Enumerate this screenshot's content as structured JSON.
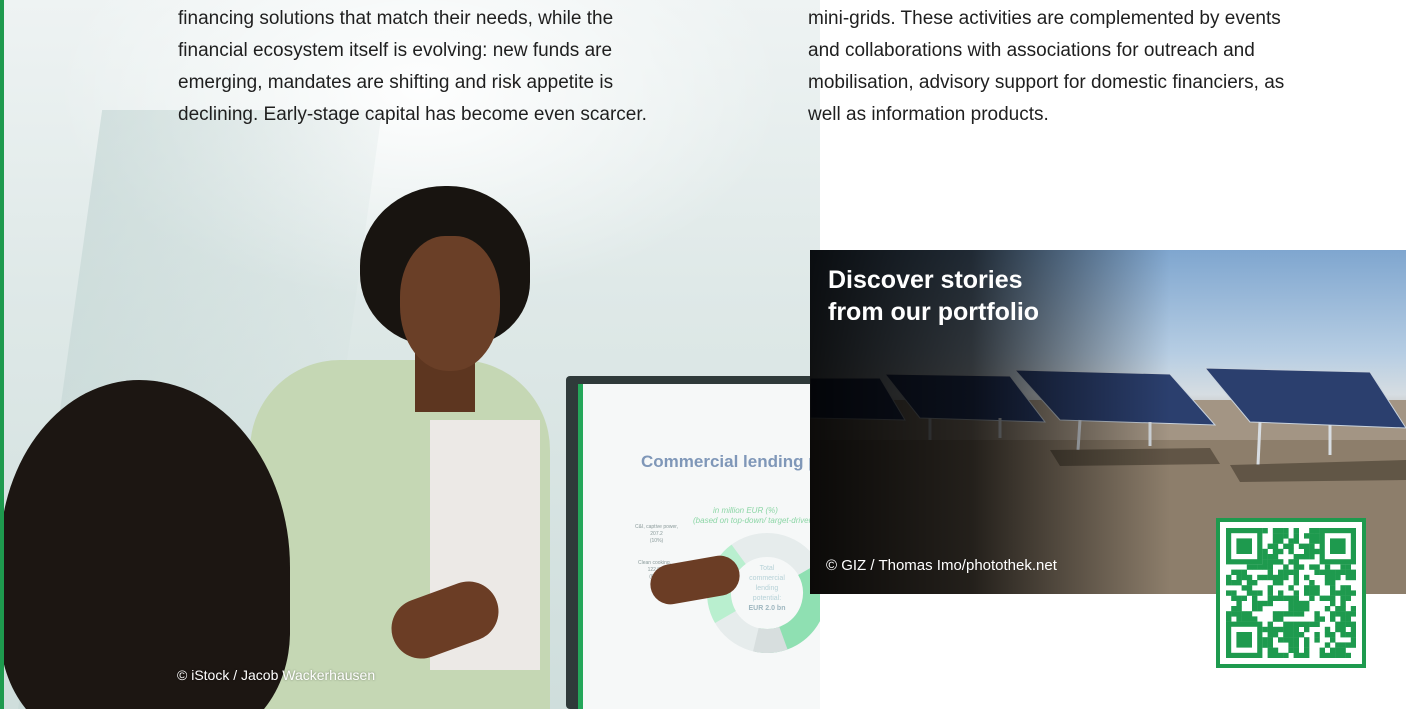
{
  "left_column": {
    "lines": [
      "financing solutions that match their needs, while the",
      "financial ecosystem itself is evolving: new funds are",
      "emerging, mandates are shifting and risk appetite is",
      "declining. Early-stage capital has become even scarcer."
    ]
  },
  "right_column": {
    "lines": [
      "mini-grids. These activities are complemented by events",
      "and collaborations with associations for outreach and",
      "mobilisation, advisory support for domestic financiers, as",
      "well as information products."
    ]
  },
  "office_photo": {
    "credit": "© iStock / Jacob Wackerhausen",
    "screen": {
      "title": "Commercial lending p",
      "subtitle_1": "in million EUR (%)",
      "subtitle_2": "(based on top-down/ target-driven a",
      "center_1": "Total",
      "center_2": "commercial",
      "center_3": "lending",
      "center_4": "potential:",
      "center_5": "EUR 2.0 bn",
      "note_ci": "C&I, captive power,",
      "note_ci_val": "207.2",
      "note_ci_pct": "(10%)",
      "note_cc": "Clean cooking,",
      "note_cc_val": "122.9,",
      "note_cc_pct": "(6%)"
    }
  },
  "portfolio_card": {
    "title_line1": "Discover stories",
    "title_line2": "from our portfolio",
    "credit": "© GIZ / Thomas Imo/photothek.net"
  },
  "colors": {
    "accent_green": "#1e9a4e",
    "text": "#1f1f1f"
  }
}
